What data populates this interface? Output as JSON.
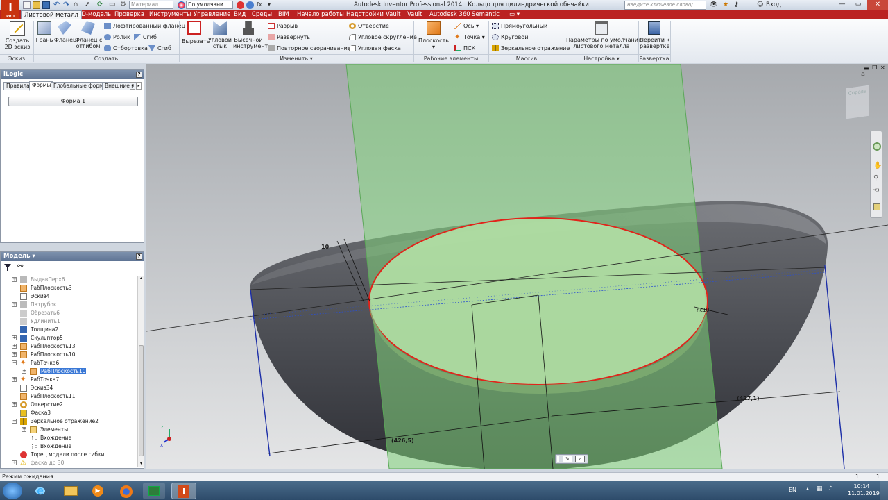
{
  "titlebar": {
    "app_title": "Autodesk Inventor Professional 2014",
    "doc_title": "Кольцо для цилиндрической обечайки",
    "material": "Материал",
    "appearance": "По умолчани",
    "search_placeholder": "Введите ключевое слово/фразу",
    "signin": "Вход"
  },
  "tabs": [
    "Листовой металл",
    "3D-модель",
    "Проверка",
    "Инструменты",
    "Управление",
    "Вид",
    "Среды",
    "BIM",
    "Начало работы",
    "Надстройки",
    "Vault",
    "Vault",
    "Autodesk 360",
    "Semantic"
  ],
  "ribbon": {
    "sketch": {
      "create_2d_line1": "Создать",
      "create_2d_line2": "2D эскиз",
      "group": "Эскиз"
    },
    "create": {
      "face": "Грань",
      "flange": "Фланец",
      "flange_bend_line1": "Фланец с",
      "flange_bend_line2": "отгибом",
      "lofted_flange": "Лофтированный фланец",
      "roll": "Ролик",
      "bend": "Сгиб",
      "contour_roll": "Отбортовка",
      "fold": "Сгиб",
      "group": "Создать"
    },
    "modify": {
      "cut": "Вырезать",
      "corner_line1": "Угловой",
      "corner_line2": "стык",
      "punch_line1": "Высечной",
      "punch_line2": "инструмент",
      "rip": "Разрыв",
      "unfold": "Развернуть",
      "refold": "Повторное сворачивание",
      "hole": "Отверстие",
      "corner_round": "Угловое скругление",
      "corner_chamfer": "Угловая фаска",
      "group": "Изменить ▾"
    },
    "work": {
      "plane": "Плоскость",
      "axis": "Ось",
      "point": "Точка",
      "ucs": "ПСК",
      "group": "Рабочие элементы"
    },
    "pattern": {
      "rect": "Прямоугольный",
      "circ": "Круговой",
      "mirror": "Зеркальное отражение",
      "group": "Массив"
    },
    "setup": {
      "defaults_line1": "Параметры по умолчанию",
      "defaults_line2": "листового металла",
      "group": "Настройка ▾"
    },
    "flat": {
      "goto_line1": "Перейти к",
      "goto_line2": "развертке",
      "group": "Развертка"
    }
  },
  "ilogic": {
    "title": "iLogic",
    "tabs": [
      "Правила",
      "Формы",
      "Глобальные формы",
      "Внешние г"
    ],
    "form_button": "Форма 1"
  },
  "model": {
    "title": "Модель ▾",
    "tree": [
      {
        "label": "ВыдавПерх6",
        "dim": true
      },
      {
        "label": "РабПлоскость3",
        "dim": false
      },
      {
        "label": "Эскиз4",
        "dim": false
      },
      {
        "label": "Патрубок",
        "dim": true
      },
      {
        "label": "Обрезать6",
        "dim": true
      },
      {
        "label": "Удлинить1",
        "dim": true
      },
      {
        "label": "Толщина2",
        "dim": false
      },
      {
        "label": "Скульптор5",
        "dim": false
      },
      {
        "label": "РабПлоскость13",
        "dim": false
      },
      {
        "label": "РабПлоскость10",
        "dim": false
      },
      {
        "label": "РабТочка6",
        "dim": false
      },
      {
        "label": "РабПлоскость10",
        "dim": false
      },
      {
        "label": "РабТочка7",
        "dim": false
      },
      {
        "label": "Эскиз34",
        "dim": false
      },
      {
        "label": "РабПлоскость11",
        "dim": false
      },
      {
        "label": "Отверстие2",
        "dim": false
      },
      {
        "label": "Фаска3",
        "dim": false
      },
      {
        "label": "Зеркальное отражение2",
        "dim": false
      },
      {
        "label": "Элементы",
        "dim": false
      },
      {
        "label": "Вхождение",
        "dim": false
      },
      {
        "label": "Вхождение",
        "dim": false
      },
      {
        "label": "Торец модели после гибки",
        "dim": false
      },
      {
        "label": "фаска до 30",
        "dim": true
      }
    ]
  },
  "viewport": {
    "viewcube_label": "Справа",
    "dim_thickness": "10",
    "dim_right": "(427,1)",
    "dim_left": "(426,5)",
    "dim_point": "hc10"
  },
  "status": {
    "text": "Режим ожидания",
    "count1": "1",
    "count2": "1"
  },
  "taskbar": {
    "lang": "EN",
    "time": "10:14",
    "date": "11.01.2019"
  }
}
